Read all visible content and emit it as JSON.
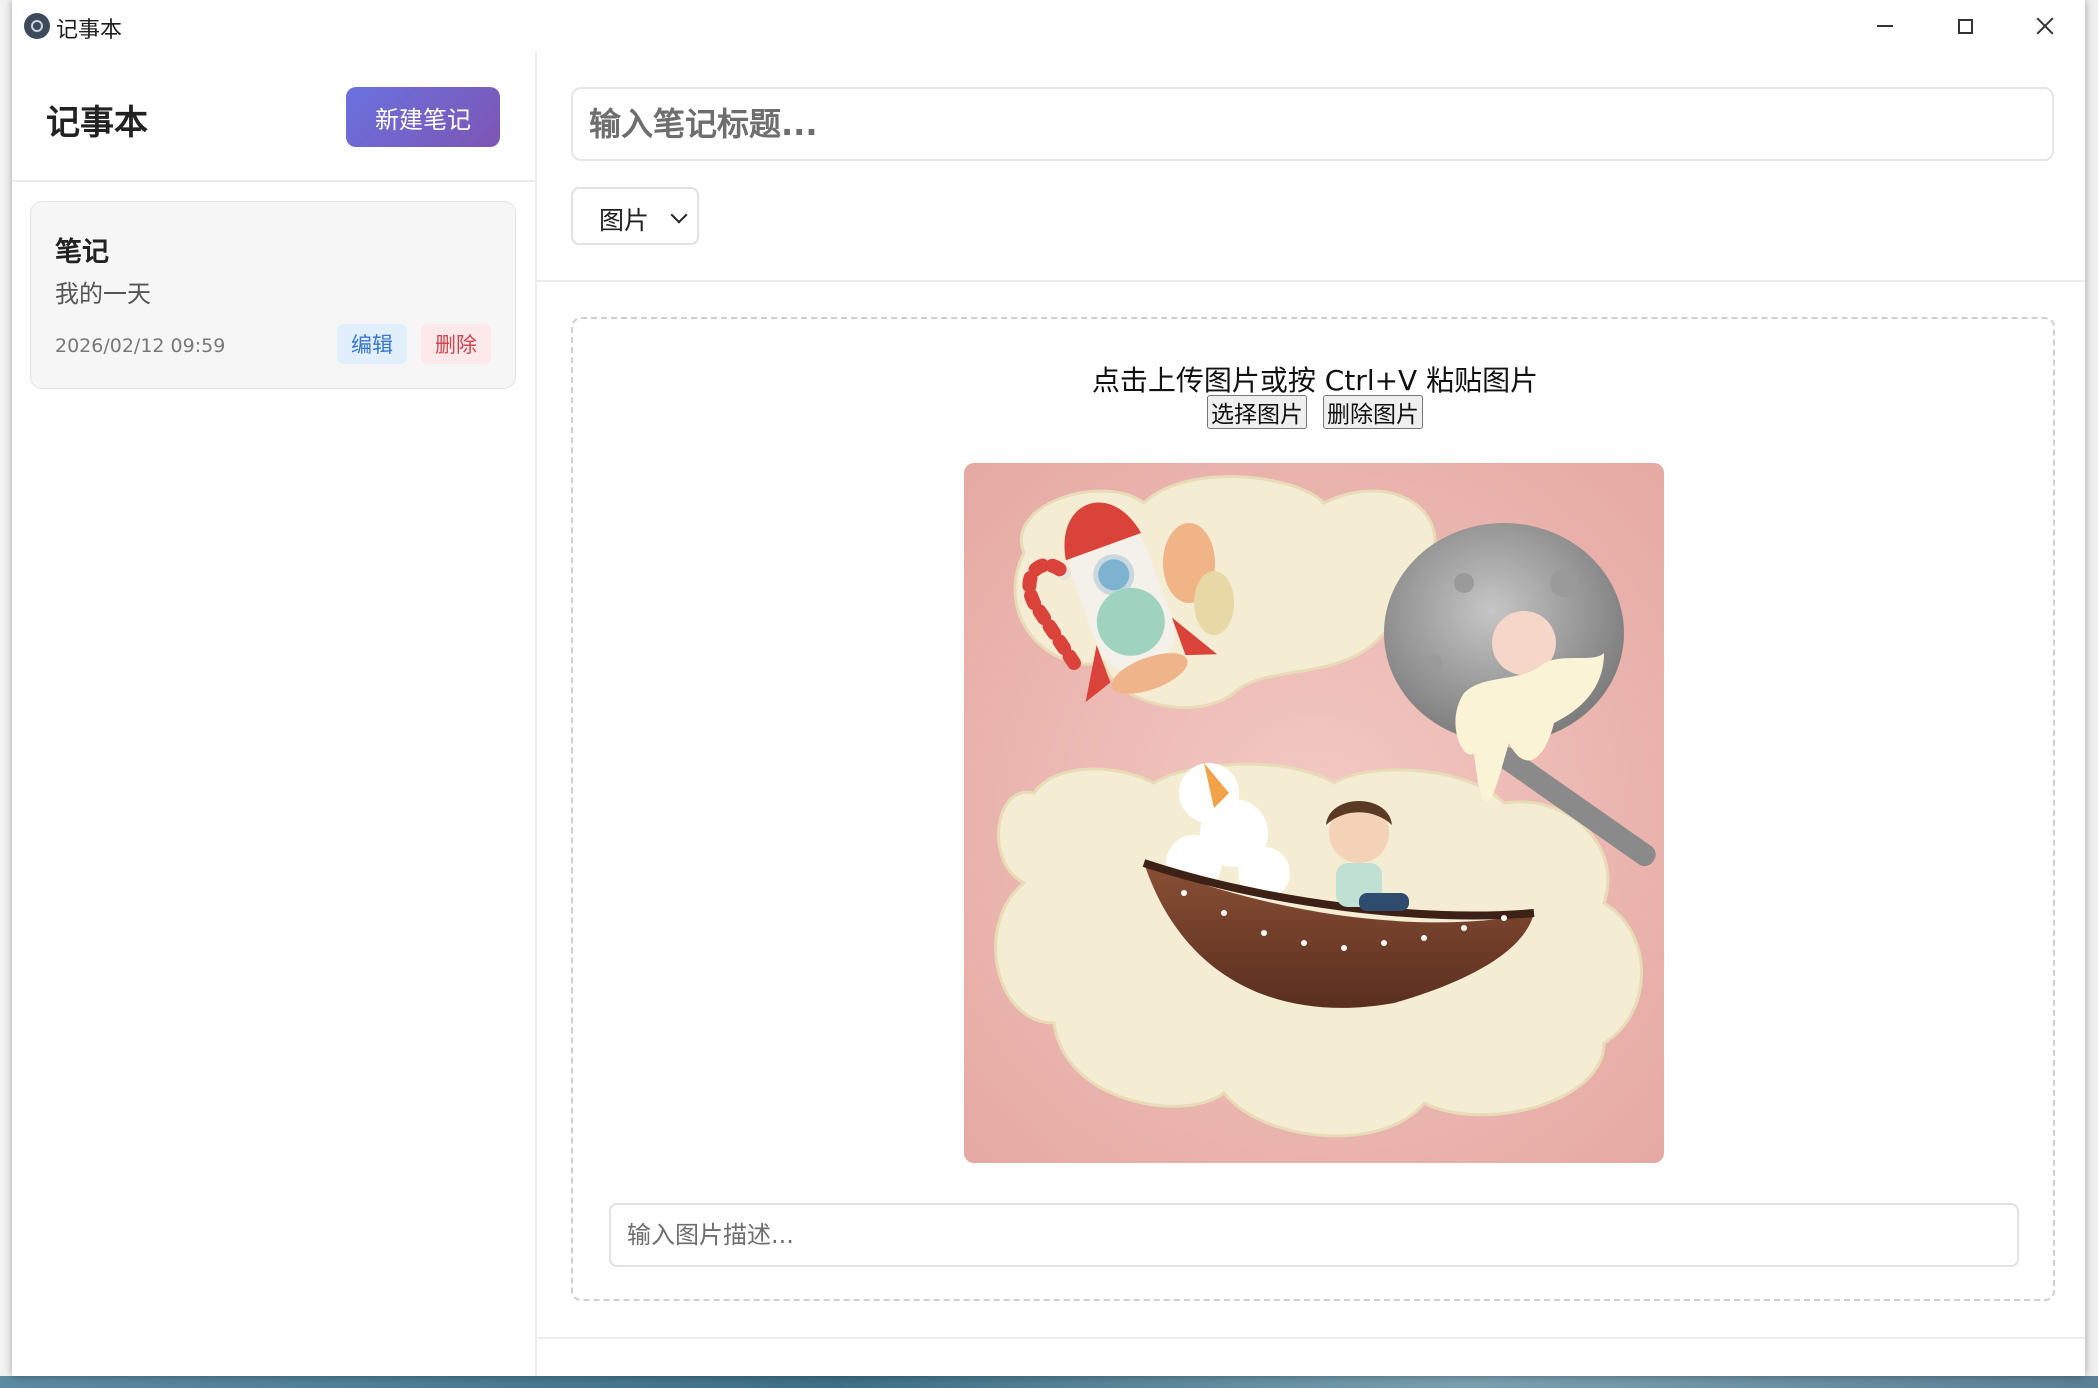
{
  "window": {
    "title": "记事本"
  },
  "sidebar": {
    "title": "记事本",
    "new_note_label": "新建笔记",
    "notes": [
      {
        "title": "笔记",
        "preview": "我的一天",
        "date": "2026/02/12 09:59",
        "edit_label": "编辑",
        "delete_label": "删除"
      }
    ]
  },
  "editor": {
    "title_placeholder": "输入笔记标题...",
    "type_selected": "图片",
    "upload_hint": "点击上传图片或按 Ctrl+V 粘贴图片",
    "choose_image_label": "选择图片",
    "delete_image_label": "删除图片",
    "description_placeholder": "输入图片描述...",
    "image_subject": "clay art: rocket, boat with boy, moon spoon on cream clouds"
  },
  "colors": {
    "accent_start": "#6a72e0",
    "accent_end": "#7d55b3",
    "edit": "#3877c9",
    "delete": "#d2444f"
  }
}
